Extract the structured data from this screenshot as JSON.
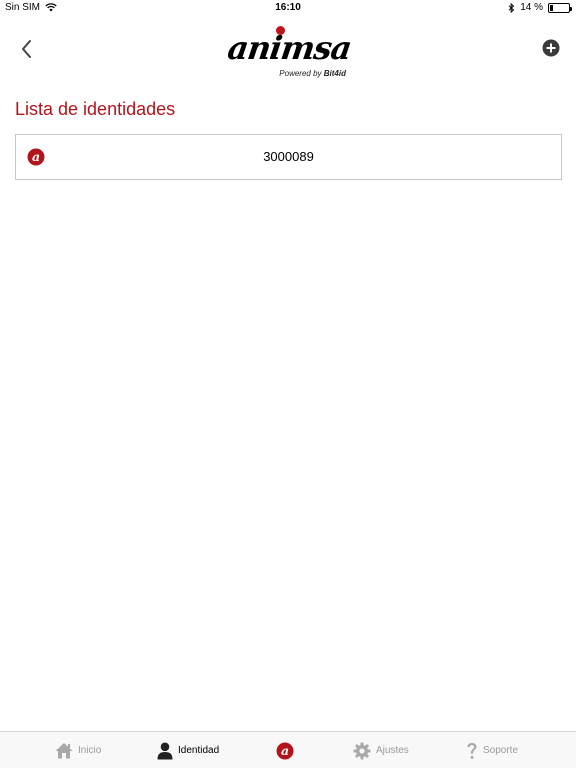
{
  "status_bar": {
    "carrier": "Sin SIM",
    "time": "16:10",
    "battery_text": "14 %",
    "battery_level": 0.14,
    "icons": [
      "wifi-icon",
      "bluetooth-icon",
      "battery-icon"
    ]
  },
  "header": {
    "logo_text": "animsa",
    "powered_prefix": "Powered by ",
    "powered_brand": "Bit4id",
    "back_icon": "chevron-left-icon",
    "add_icon": "plus-circle-icon"
  },
  "page": {
    "title": "Lista de identidades"
  },
  "identities": [
    {
      "id": "3000089",
      "icon": "animsa-logo-icon"
    }
  ],
  "tabs": [
    {
      "label": "Inicio",
      "icon": "home-icon",
      "active": false
    },
    {
      "label": "Identidad",
      "icon": "person-icon",
      "active": true
    },
    {
      "label": "",
      "icon": "animsa-logo-icon",
      "active": false
    },
    {
      "label": "Ajustes",
      "icon": "gear-icon",
      "active": false
    },
    {
      "label": "Soporte",
      "icon": "question-icon",
      "active": false
    }
  ],
  "colors": {
    "accent": "#b3141b",
    "tab_inactive": "#9a9a9a",
    "tab_active": "#000000",
    "border": "#c8c8c8"
  }
}
